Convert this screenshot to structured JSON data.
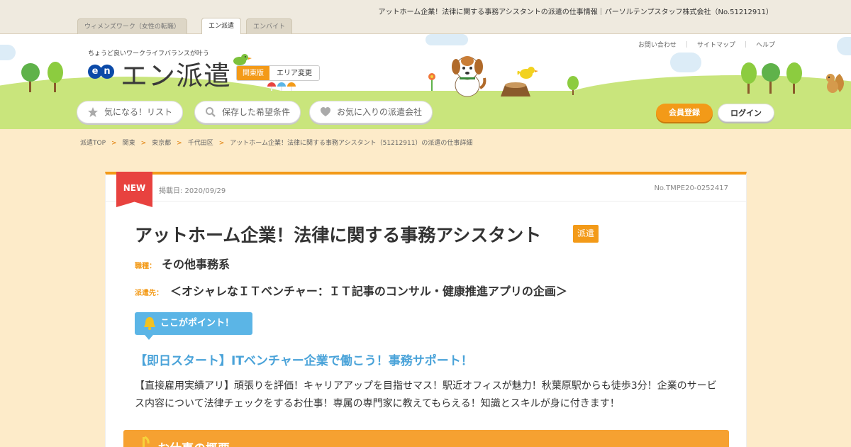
{
  "site_title": "アットホーム企業！法律に関する事務アシスタントの派遣の仕事情報｜パーソルテンプスタッフ株式会社（No.51212911）",
  "tabs": [
    {
      "label": "ウィメンズワーク（女性の転職）"
    },
    {
      "label": "エン派遣"
    },
    {
      "label": "エンバイト"
    }
  ],
  "header": {
    "tagline": "ちょうど良いワークライフバランスが叶う",
    "logo_mark": "en",
    "logo_text": "エン派遣",
    "region_current": "関東版",
    "region_change": "エリア変更",
    "util_links": [
      "お問い合わせ",
      "サイトマップ",
      "ヘルプ"
    ],
    "nav": [
      {
        "label": "気になる！リスト",
        "icon": "star-icon"
      },
      {
        "label": "保存した希望条件",
        "icon": "search-icon"
      },
      {
        "label": "お気に入りの派遣会社",
        "icon": "heart-icon"
      }
    ],
    "register": "会員登録",
    "login": "ログイン"
  },
  "breadcrumb": [
    "派遣TOP",
    "関東",
    "東京都",
    "千代田区",
    "アットホーム企業！法律に関する事務アシスタント（51212911）の派遣の仕事詳細"
  ],
  "job": {
    "new_label": "NEW",
    "published": "掲載日: 2020/09/29",
    "job_no": "No.TMPE20-0252417",
    "title": "アットホーム企業！法律に関する事務アシスタント",
    "type_badge": "派遣",
    "category_label": "職種：",
    "category": "その他事務系",
    "dest_label": "派遣先：",
    "dest": "＜オシャレなＩＴベンチャー：ＩＴ記事のコンサル・健康推進アプリの企画＞",
    "point_label": "ここがポイント！",
    "catch": "【即日スタート】ITベンチャー企業で働こう！事務サポート！",
    "body": "【直接雇用実績アリ】頑張りを評価！キャリアアップを目指せマス！駅近オフィスが魅力！秋葉原駅からも徒歩3分！企業のサービス内容について法律チェックをするお仕事！専属の専門家に教えてもらえる！知識とスキルが身に付きます！",
    "section_title": "お仕事の概要"
  },
  "colors": {
    "accent": "#f39a18",
    "point": "#5bb5e6",
    "catch": "#4aa3d9",
    "new": "#e8423f"
  }
}
